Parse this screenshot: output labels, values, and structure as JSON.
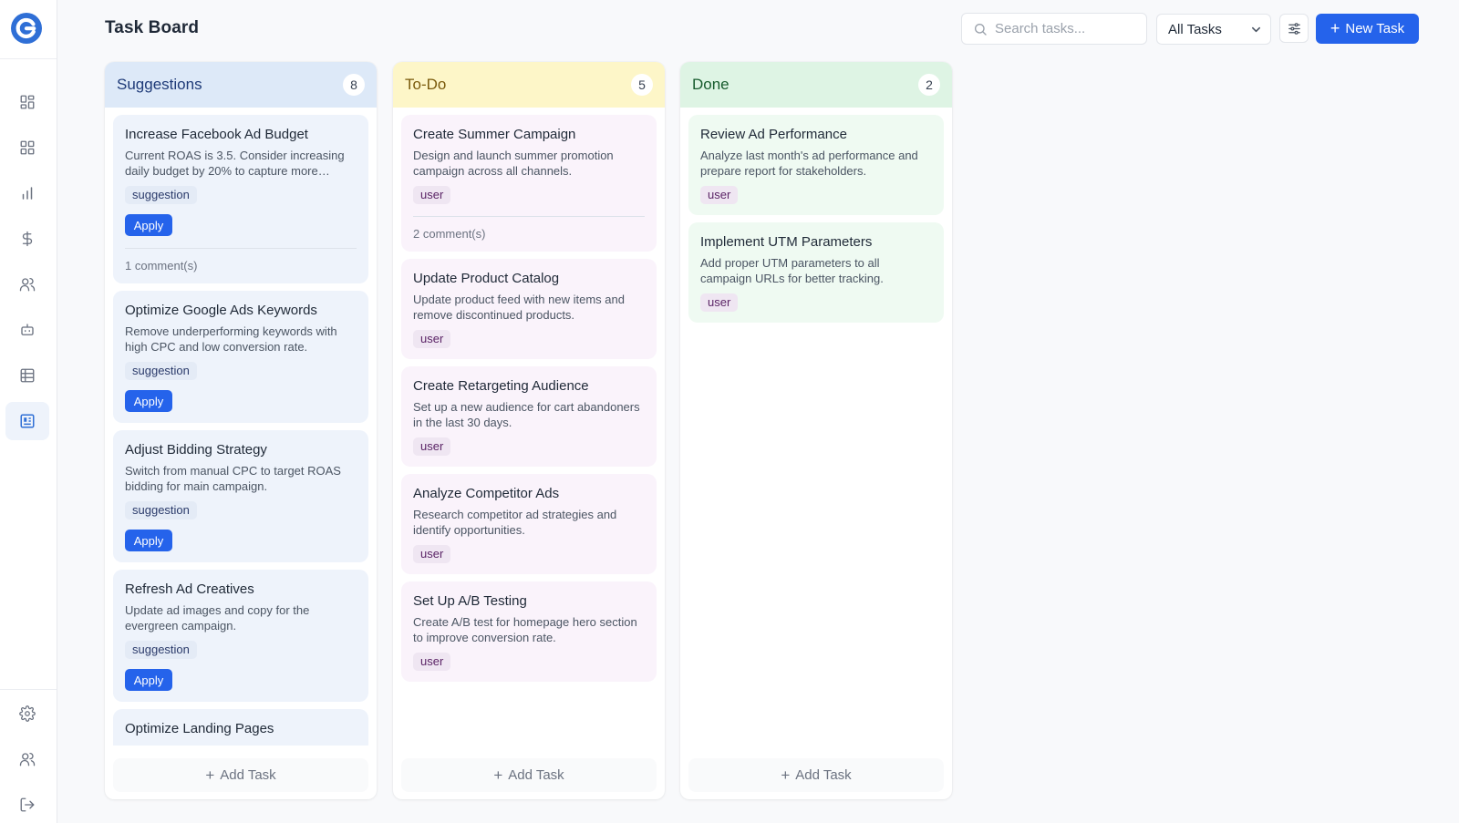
{
  "app": {
    "brand_color": "#2f6fd6",
    "accent": "#2563eb"
  },
  "sidebar": {
    "items": [
      {
        "name": "dashboard-icon"
      },
      {
        "name": "apps-icon"
      },
      {
        "name": "analytics-icon"
      },
      {
        "name": "dollar-icon"
      },
      {
        "name": "users-icon"
      },
      {
        "name": "bot-icon"
      },
      {
        "name": "table-icon"
      },
      {
        "name": "board-icon",
        "active": true
      }
    ],
    "bottom": [
      {
        "name": "gear-icon"
      },
      {
        "name": "team-icon"
      },
      {
        "name": "logout-icon"
      }
    ]
  },
  "header": {
    "title": "Task Board",
    "search_placeholder": "Search tasks...",
    "filter_selected": "All Tasks",
    "new_task_label": "New Task"
  },
  "columns": [
    {
      "title": "Suggestions",
      "count": "8",
      "header_bg": "#dde9f8",
      "title_color": "#1e3a78",
      "card_bg": "#eef3fb",
      "add_label": "Add Task",
      "cards": [
        {
          "title": "Increase Facebook Ad Budget",
          "desc": "Current ROAS is 3.5. Consider increasing daily budget by 20% to capture more…",
          "tag": "suggestion",
          "apply": "Apply",
          "comments": "1 comment(s)"
        },
        {
          "title": "Optimize Google Ads Keywords",
          "desc": "Remove underperforming keywords with high CPC and low conversion rate.",
          "tag": "suggestion",
          "apply": "Apply"
        },
        {
          "title": "Adjust Bidding Strategy",
          "desc": "Switch from manual CPC to target ROAS bidding for main campaign.",
          "tag": "suggestion",
          "apply": "Apply"
        },
        {
          "title": "Refresh Ad Creatives",
          "desc": "Update ad images and copy for the evergreen campaign.",
          "tag": "suggestion",
          "apply": "Apply"
        },
        {
          "title": "Optimize Landing Pages",
          "desc": "",
          "tag": "",
          "apply": ""
        }
      ]
    },
    {
      "title": "To-Do",
      "count": "5",
      "header_bg": "#fdf6c8",
      "title_color": "#7a5a0c",
      "card_bg": "#faf3fb",
      "add_label": "Add Task",
      "cards": [
        {
          "title": "Create Summer Campaign",
          "desc": "Design and launch summer promotion campaign across all channels.",
          "tag": "user",
          "comments": "2 comment(s)"
        },
        {
          "title": "Update Product Catalog",
          "desc": "Update product feed with new items and remove discontinued products.",
          "tag": "user"
        },
        {
          "title": "Create Retargeting Audience",
          "desc": "Set up a new audience for cart abandoners in the last 30 days.",
          "tag": "user"
        },
        {
          "title": "Analyze Competitor Ads",
          "desc": "Research competitor ad strategies and identify opportunities.",
          "tag": "user"
        },
        {
          "title": "Set Up A/B Testing",
          "desc": "Create A/B test for homepage hero section to improve conversion rate.",
          "tag": "user"
        }
      ]
    },
    {
      "title": "Done",
      "count": "2",
      "header_bg": "#def4e4",
      "title_color": "#185c2e",
      "card_bg": "#effaf2",
      "add_label": "Add Task",
      "cards": [
        {
          "title": "Review Ad Performance",
          "desc": "Analyze last month's ad performance and prepare report for stakeholders.",
          "tag": "user"
        },
        {
          "title": "Implement UTM Parameters",
          "desc": "Add proper UTM parameters to all campaign URLs for better tracking.",
          "tag": "user"
        }
      ]
    }
  ]
}
